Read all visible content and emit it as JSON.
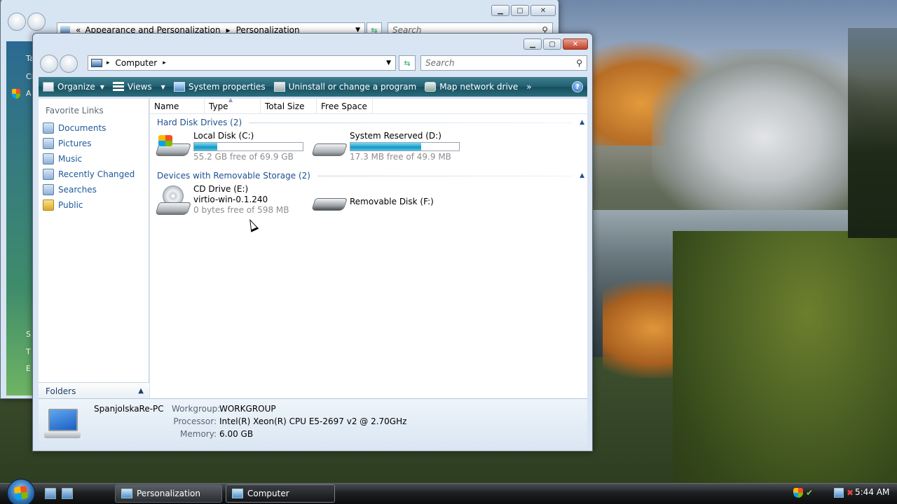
{
  "background_window": {
    "breadcrumb_prefix": "«",
    "breadcrumb_1": "Appearance and Personalization",
    "breadcrumb_2": "Personalization",
    "search_placeholder": "Search",
    "strip_texts": [
      "Ta",
      "Cl",
      "A",
      "S",
      "T",
      "E"
    ]
  },
  "computer_window": {
    "address": "Computer",
    "search_placeholder": "Search",
    "toolbar": {
      "organize": "Organize",
      "views": "Views",
      "system_properties": "System properties",
      "uninstall": "Uninstall or change a program",
      "map_drive": "Map network drive",
      "more": "»"
    },
    "favorites_title": "Favorite Links",
    "favorites": [
      "Documents",
      "Pictures",
      "Music",
      "Recently Changed",
      "Searches",
      "Public"
    ],
    "folders_label": "Folders",
    "columns": [
      "Name",
      "Type",
      "Total Size",
      "Free Space"
    ],
    "groups": {
      "hdd": "Hard Disk Drives (2)",
      "removable": "Devices with Removable Storage (2)"
    },
    "drives": {
      "c": {
        "name": "Local Disk (C:)",
        "free": "55.2 GB free of 69.9 GB",
        "used_fraction": 0.21
      },
      "d": {
        "name": "System Reserved (D:)",
        "free": "17.3 MB free of 49.9 MB",
        "used_fraction": 0.65
      },
      "e": {
        "name": "CD Drive (E:)",
        "label": "virtio-win-0.1.240",
        "free": "0 bytes free of 598 MB"
      },
      "f": {
        "name": "Removable Disk (F:)"
      }
    },
    "details": {
      "pc_name": "SpanjolskaRe-PC",
      "workgroup_label": "Workgroup:",
      "workgroup": "WORKGROUP",
      "processor_label": "Processor:",
      "processor": "Intel(R) Xeon(R) CPU E5-2697 v2 @ 2.70GHz",
      "memory_label": "Memory:",
      "memory": "6.00 GB"
    }
  },
  "taskbar": {
    "tasks": [
      "Personalization",
      "Computer"
    ],
    "clock": "5:44 AM"
  }
}
